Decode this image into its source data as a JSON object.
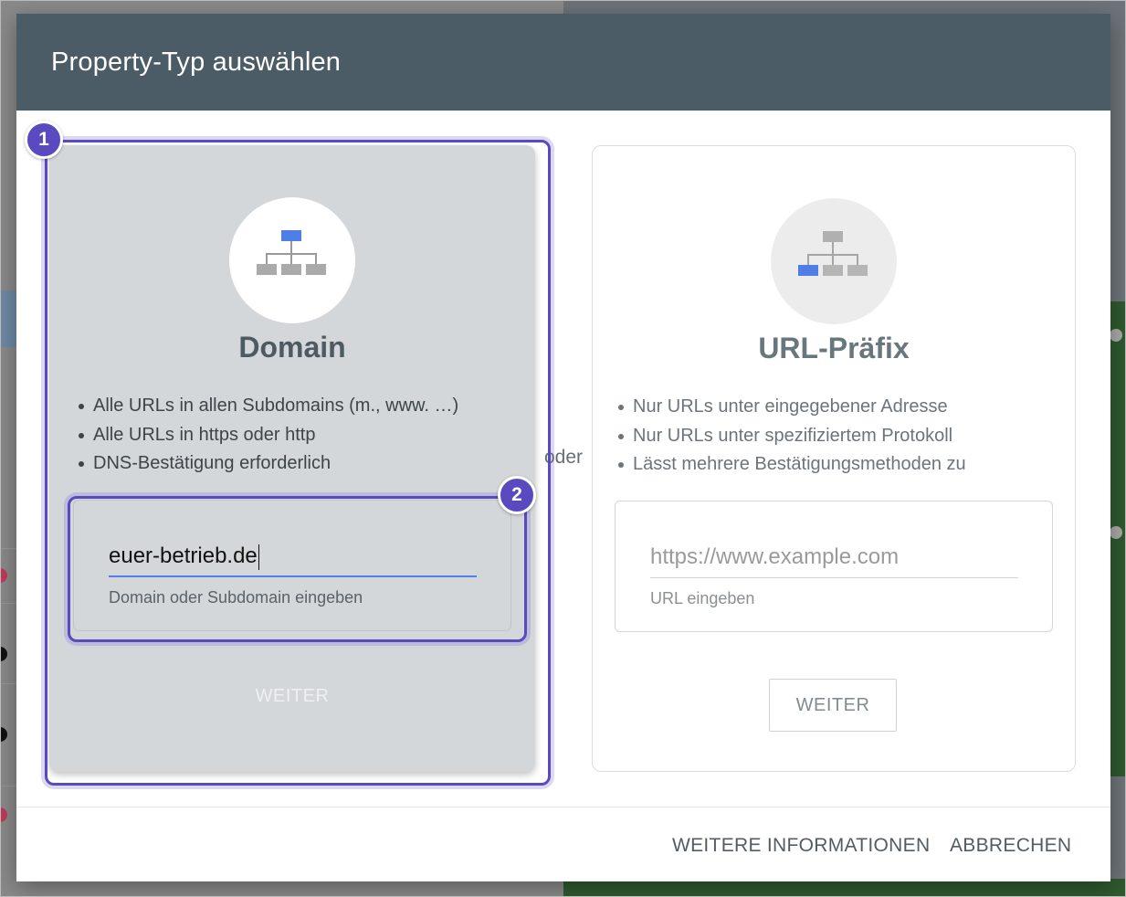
{
  "dialog": {
    "title": "Property-Typ auswählen"
  },
  "domain_card": {
    "icon": "sitemap-icon",
    "title": "Domain",
    "bullets": [
      "Alle URLs in allen Subdomains (m., www. …)",
      "Alle URLs in https oder http",
      "DNS-Bestätigung erforderlich"
    ],
    "input_value": "euer-betrieb.de",
    "helper_text": "Domain oder Subdomain eingeben",
    "button_label": "WEITER"
  },
  "separator": "oder",
  "url_card": {
    "icon": "sitemap-icon",
    "title": "URL-Präfix",
    "bullets": [
      "Nur URLs unter eingegebener Adresse",
      "Nur URLs unter spezifiziertem Protokoll",
      "Lässt mehrere Bestätigungsmethoden zu"
    ],
    "input_placeholder": "https://www.example.com",
    "helper_text": "URL eingeben",
    "button_label": "WEITER"
  },
  "footer": {
    "more_info_label": "WEITERE INFORMATIONEN",
    "cancel_label": "ABBRECHEN"
  },
  "annotations": {
    "badge_1": "1",
    "badge_2": "2"
  },
  "colors": {
    "header_bg": "#4b5c66",
    "highlight": "#5a4ac0",
    "input_accent": "#5282e8",
    "icon_active": "#4f7fe6",
    "icon_inactive": "#b0b0b0"
  }
}
